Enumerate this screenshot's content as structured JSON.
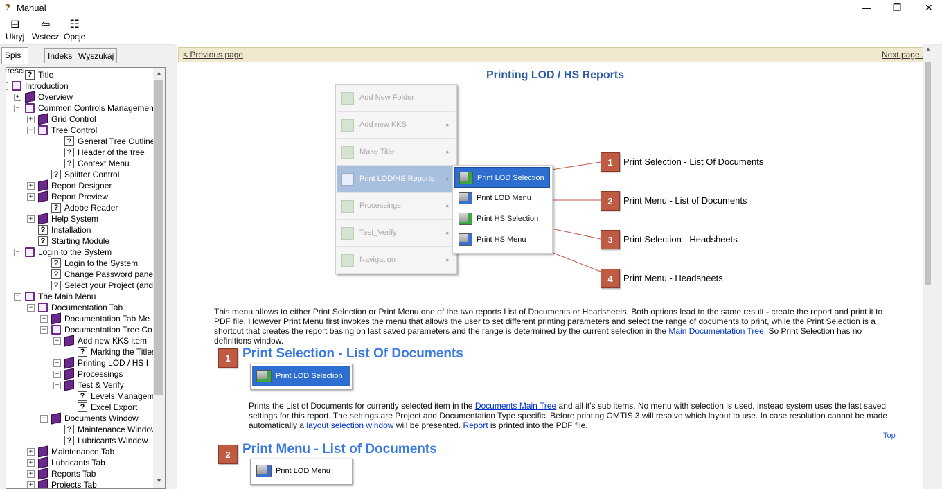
{
  "window": {
    "title": "Manual",
    "minimize_glyph": "—",
    "restore_glyph": "❐",
    "close_glyph": "✕"
  },
  "toolbar": {
    "hide_label": "Ukryj",
    "back_label": "Wstecz",
    "options_label": "Opcje"
  },
  "tabs": [
    "Spis treści",
    "Indeks",
    "Wyszukaj"
  ],
  "tree": [
    {
      "label": "Title",
      "level": 1,
      "icon": "page",
      "exp": ""
    },
    {
      "label": "Introduction",
      "level": 0,
      "icon": "bookopen",
      "exp": "−"
    },
    {
      "label": "Overview",
      "level": 1,
      "icon": "book",
      "exp": "+"
    },
    {
      "label": "Common Controls Management",
      "level": 1,
      "icon": "bookopen",
      "exp": "−"
    },
    {
      "label": "Grid Control",
      "level": 2,
      "icon": "book",
      "exp": "+"
    },
    {
      "label": "Tree Control",
      "level": 2,
      "icon": "bookopen",
      "exp": "−"
    },
    {
      "label": "General Tree Outline",
      "level": 4,
      "icon": "page",
      "exp": ""
    },
    {
      "label": "Header of the tree",
      "level": 4,
      "icon": "page",
      "exp": ""
    },
    {
      "label": "Context Menu",
      "level": 4,
      "icon": "page",
      "exp": ""
    },
    {
      "label": "Splitter Control",
      "level": 3,
      "icon": "page",
      "exp": ""
    },
    {
      "label": "Report Designer",
      "level": 2,
      "icon": "book",
      "exp": "+"
    },
    {
      "label": "Report Preview",
      "level": 2,
      "icon": "book",
      "exp": "+"
    },
    {
      "label": "Adobe Reader",
      "level": 3,
      "icon": "page",
      "exp": ""
    },
    {
      "label": "Help System",
      "level": 2,
      "icon": "book",
      "exp": "+"
    },
    {
      "label": "Installation",
      "level": 2,
      "icon": "page",
      "exp": ""
    },
    {
      "label": "Starting Module",
      "level": 2,
      "icon": "page",
      "exp": ""
    },
    {
      "label": "Login to the System",
      "level": 1,
      "icon": "bookopen",
      "exp": "−"
    },
    {
      "label": "Login to the System",
      "level": 3,
      "icon": "page",
      "exp": ""
    },
    {
      "label": "Change Password pane",
      "level": 3,
      "icon": "page",
      "exp": ""
    },
    {
      "label": "Select your Project (and / o",
      "level": 3,
      "icon": "page",
      "exp": ""
    },
    {
      "label": "The Main Menu",
      "level": 1,
      "icon": "bookopen",
      "exp": "−"
    },
    {
      "label": "Documentation Tab",
      "level": 2,
      "icon": "bookopen",
      "exp": "−"
    },
    {
      "label": "Documentation Tab Me",
      "level": 3,
      "icon": "book",
      "exp": "+"
    },
    {
      "label": "Documentation Tree Co",
      "level": 3,
      "icon": "bookopen",
      "exp": "−"
    },
    {
      "label": "Add new KKS item",
      "level": 4,
      "icon": "book",
      "exp": "+"
    },
    {
      "label": "Marking the Titles a",
      "level": 5,
      "icon": "page",
      "exp": ""
    },
    {
      "label": "Printing LOD / HS I",
      "level": 4,
      "icon": "book",
      "exp": "+"
    },
    {
      "label": "Processings",
      "level": 4,
      "icon": "book",
      "exp": "+"
    },
    {
      "label": "Test & Verify",
      "level": 4,
      "icon": "book",
      "exp": "+"
    },
    {
      "label": "Levels Managemen",
      "level": 5,
      "icon": "page",
      "exp": ""
    },
    {
      "label": "Excel Export",
      "level": 5,
      "icon": "page",
      "exp": ""
    },
    {
      "label": "Documents Window",
      "level": 3,
      "icon": "book",
      "exp": "+"
    },
    {
      "label": "Maintenance Window",
      "level": 4,
      "icon": "page",
      "exp": ""
    },
    {
      "label": "Lubricants Window",
      "level": 4,
      "icon": "page",
      "exp": ""
    },
    {
      "label": "Maintenance Tab",
      "level": 2,
      "icon": "book",
      "exp": "+"
    },
    {
      "label": "Lubricants Tab",
      "level": 2,
      "icon": "book",
      "exp": "+"
    },
    {
      "label": "Reports Tab",
      "level": 2,
      "icon": "book",
      "exp": "+"
    },
    {
      "label": "Projects Tab",
      "level": 2,
      "icon": "book",
      "exp": "+"
    }
  ],
  "content": {
    "prev_page": "< Previous page",
    "next_page": "Next page >",
    "title": "Printing LOD / HS Reports",
    "context_menu": [
      {
        "label": "Add New Folder",
        "arrow": ""
      },
      {
        "label": "Add new KKS",
        "arrow": "▸"
      },
      {
        "label": "Make Title",
        "arrow": "▸"
      },
      {
        "label": "Print LOD/HS Reports",
        "arrow": "▸"
      },
      {
        "label": "Processings",
        "arrow": "▸"
      },
      {
        "label": "Test_Verify",
        "arrow": "▸"
      },
      {
        "label": "Navigation",
        "arrow": "▸"
      }
    ],
    "submenu": [
      "Print LOD Selection",
      "Print LOD Menu",
      "Print HS Selection",
      "Print HS Menu"
    ],
    "callouts": [
      {
        "num": "1",
        "text": "Print Selection - List Of Documents"
      },
      {
        "num": "2",
        "text": "Print Menu - List of Documents"
      },
      {
        "num": "3",
        "text": "Print Selection - Headsheets"
      },
      {
        "num": "4",
        "text": "Print Menu - Headsheets"
      }
    ],
    "intro_text_1": "This menu allows to either Print Selection or Print Menu one of the two reports List of Documents or Headsheets. Both options lead to the same result - create the report and print it to PDF file. However Print Menu first invokes the menu that allows the user to set different printing parameters and select the range of documents to print,  while the Print Selection is a shortcut that creates the report basing on last saved parameters and the range is determined by the current selection in the ",
    "intro_link": "Main Documentation Tree",
    "intro_text_2": ". So Print Selection has no definitions window.",
    "section1": {
      "num": "1",
      "title": "Print Selection - List Of Documents",
      "button": "Print LOD Selection"
    },
    "section1_text_1": "Prints the List of Documents for currently selected item in the ",
    "section1_link_1": "Documents Main Tree",
    "section1_text_2": " and all it's sub items. No menu with selection is used, instead system uses the last saved settings for this report. The settings are Project and Documentation Type specific. Before printing OMTIS 3 will resolve which layout to use. In case resolution cannot be made automatically a",
    "section1_link_2": " layout selection window",
    "section1_text_3": " will be presented. ",
    "section1_link_3": "Report",
    "section1_text_4": " is printed into the PDF file.",
    "top_link": "Top",
    "section2": {
      "num": "2",
      "title": "Print Menu - List of Documents",
      "button": "Print LOD Menu"
    }
  }
}
